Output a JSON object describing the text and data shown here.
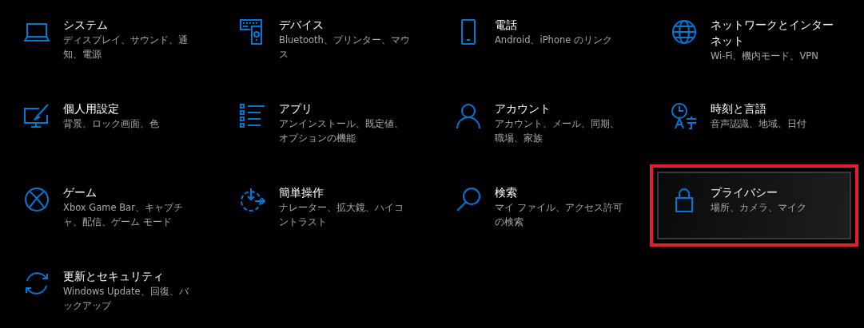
{
  "items": [
    {
      "kind": "laptop",
      "title": "システム",
      "subtitle": "ディスプレイ、サウンド、通知、電源",
      "selected": false
    },
    {
      "kind": "devices",
      "title": "デバイス",
      "subtitle": "Bluetooth、プリンター、マウス",
      "selected": false
    },
    {
      "kind": "phone",
      "title": "電話",
      "subtitle": "Android、iPhone のリンク",
      "selected": false
    },
    {
      "kind": "globe",
      "title": "ネットワークとインターネット",
      "subtitle": "Wi-Fi、機内モード、VPN",
      "selected": false
    },
    {
      "kind": "paint",
      "title": "個人用設定",
      "subtitle": "背景、ロック画面、色",
      "selected": false
    },
    {
      "kind": "list",
      "title": "アプリ",
      "subtitle": "アンインストール、既定値、オプションの機能",
      "selected": false
    },
    {
      "kind": "person",
      "title": "アカウント",
      "subtitle": "アカウント、メール、同期、職場、家族",
      "selected": false
    },
    {
      "kind": "clock",
      "title": "時刻と言語",
      "subtitle": "音声認識、地域、日付",
      "selected": false
    },
    {
      "kind": "xbox",
      "title": "ゲーム",
      "subtitle": "Xbox Game Bar、キャプチャ、配信、ゲーム モード",
      "selected": false
    },
    {
      "kind": "access",
      "title": "簡単操作",
      "subtitle": "ナレーター、拡大鏡、ハイコントラスト",
      "selected": false
    },
    {
      "kind": "search",
      "title": "検索",
      "subtitle": "マイ ファイル、アクセス許可の検索",
      "selected": false
    },
    {
      "kind": "lock",
      "title": "プライバシー",
      "subtitle": "場所、カメラ、マイク",
      "selected": true
    },
    {
      "kind": "sync",
      "title": "更新とセキュリティ",
      "subtitle": "Windows Update、回復、バックアップ",
      "selected": false
    }
  ]
}
